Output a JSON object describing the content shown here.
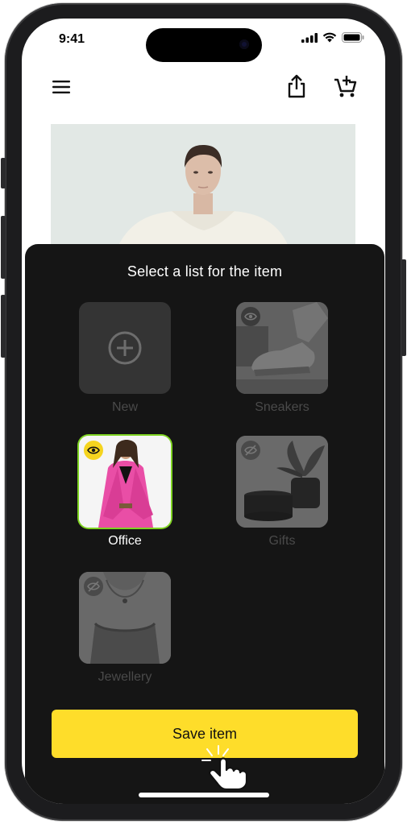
{
  "status_bar": {
    "time": "9:41"
  },
  "app_bar": {
    "menu_icon": "hamburger-menu-icon",
    "share_icon": "share-icon",
    "cart_icon": "add-to-cart-icon"
  },
  "product": {
    "image": "model-in-white-jacket-photo"
  },
  "sheet": {
    "title": "Select a list for the item",
    "lists": [
      {
        "label": "New",
        "kind": "create",
        "selected": false,
        "icon": "plus-circle-icon"
      },
      {
        "label": "Sneakers",
        "kind": "list",
        "selected": false,
        "icon": "eye-icon"
      },
      {
        "label": "Office",
        "kind": "list",
        "selected": true,
        "icon": "eye-icon"
      },
      {
        "label": "Gifts",
        "kind": "list",
        "selected": false,
        "icon": "eye-off-icon"
      },
      {
        "label": "Jewellery",
        "kind": "list",
        "selected": false,
        "icon": "eye-off-icon"
      }
    ],
    "save_label": "Save item"
  },
  "colors": {
    "sheet_bg": "#151515",
    "accent": "#fedd2a",
    "selected_outline": "#7ed321",
    "dim_label": "#4a4a4a"
  }
}
